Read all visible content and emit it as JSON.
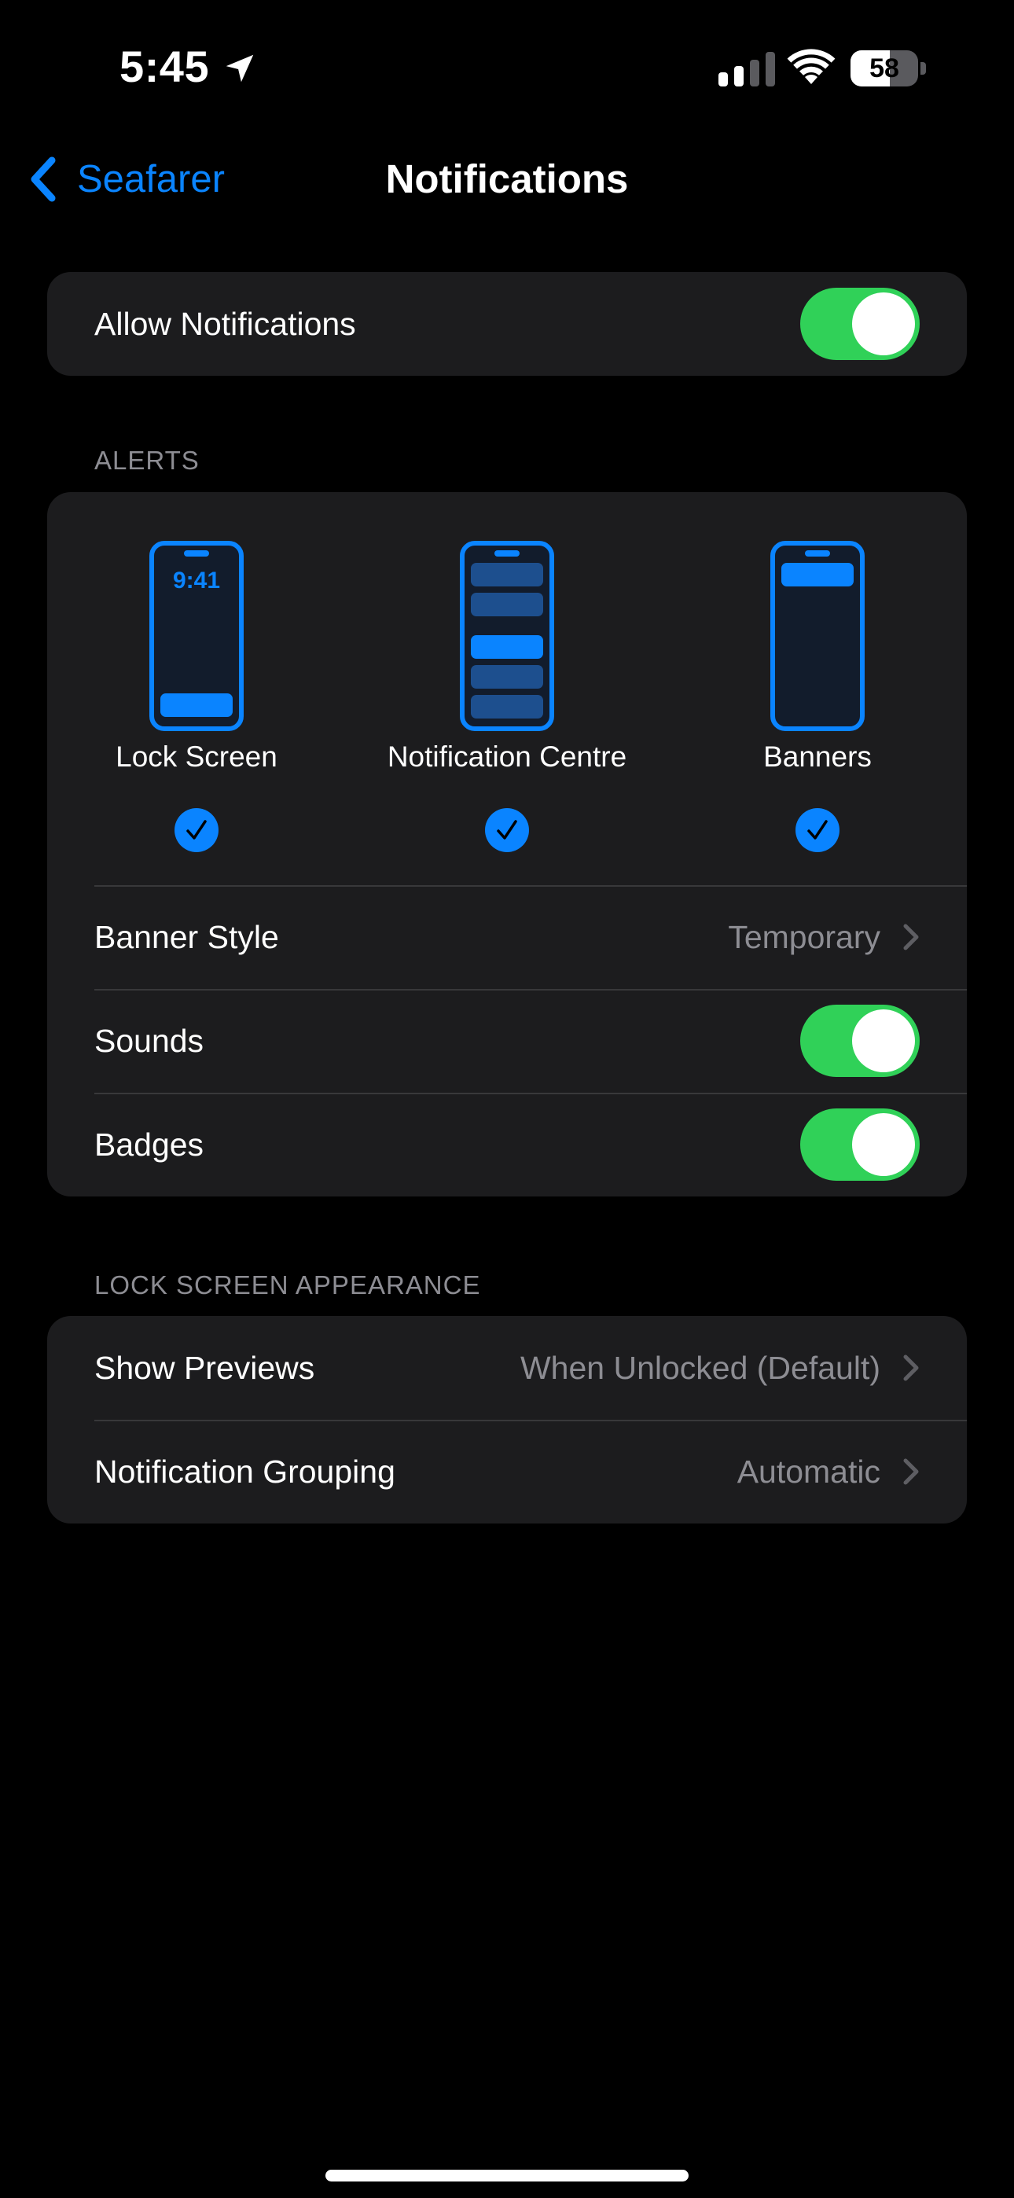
{
  "status_bar": {
    "time": "5:45",
    "battery": 58,
    "icons": [
      "location-arrow-icon",
      "cellular-signal-icon",
      "wifi-icon",
      "battery-icon"
    ]
  },
  "nav": {
    "back_label": "Seafarer",
    "title": "Notifications"
  },
  "allow_notifications": {
    "label": "Allow Notifications",
    "on": true
  },
  "alerts": {
    "header": "ALERTS",
    "options": [
      {
        "label": "Lock Screen",
        "preview_time": "9:41",
        "checked": true
      },
      {
        "label": "Notification Centre",
        "checked": true
      },
      {
        "label": "Banners",
        "checked": true
      }
    ],
    "banner_style": {
      "label": "Banner Style",
      "value": "Temporary"
    },
    "sounds": {
      "label": "Sounds",
      "on": true
    },
    "badges": {
      "label": "Badges",
      "on": true
    }
  },
  "lock_screen_appearance": {
    "header": "LOCK SCREEN APPEARANCE",
    "show_previews": {
      "label": "Show Previews",
      "value": "When Unlocked (Default)"
    },
    "grouping": {
      "label": "Notification Grouping",
      "value": "Automatic"
    }
  },
  "colors": {
    "accent": "#0a84ff",
    "toggle_on": "#30d158",
    "group_bg": "#1c1c1e",
    "secondary_text": "#8d8d93"
  }
}
